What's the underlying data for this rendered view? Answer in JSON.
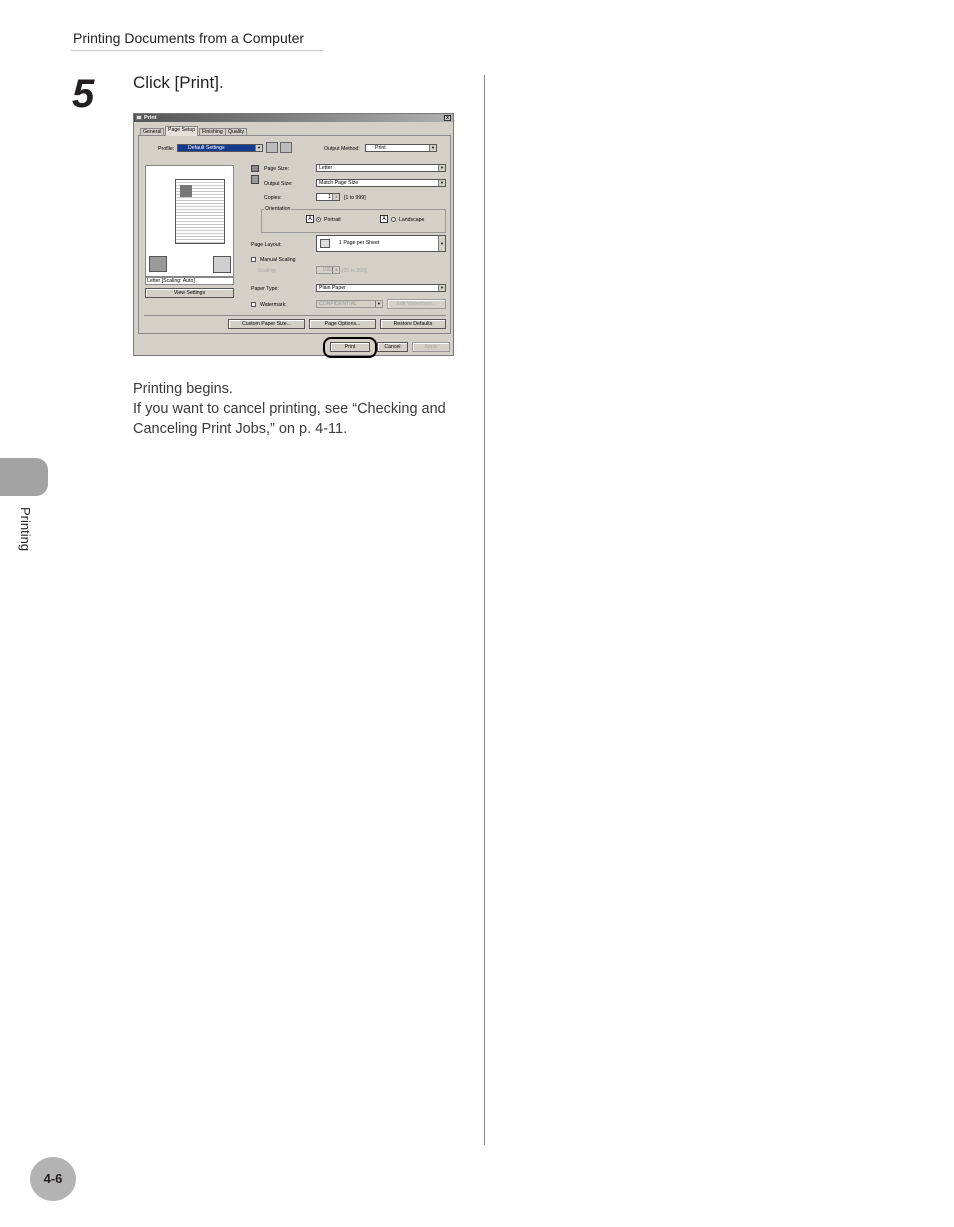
{
  "header": {
    "title": "Printing Documents from a Computer"
  },
  "step": {
    "number": "5",
    "instruction": "Click [Print]."
  },
  "body": {
    "line1": "Printing begins.",
    "line2": "If you want to cancel printing, see “Checking and Canceling Print Jobs,” on p. 4-11."
  },
  "side_tab": {
    "label": "Printing"
  },
  "page_number": "4-6",
  "dialog": {
    "title": "Print",
    "close": "x",
    "tabs": [
      "General",
      "Page Setup",
      "Finishing",
      "Quality"
    ],
    "profile_label": "Profile:",
    "profile_value": "Default Settings",
    "output_method_label": "Output Method:",
    "output_method_value": "Print",
    "preview_caption": "Letter [Scaling: Auto]",
    "view_settings": "View Settings",
    "page_size_label": "Page Size:",
    "page_size_value": "Letter",
    "output_size_label": "Output Size:",
    "output_size_value": "Match Page Size",
    "copies_label": "Copies:",
    "copies_value": "1",
    "copies_range": "[1 to 999]",
    "orientation_label": "Orientation",
    "portrait": "Portrait",
    "landscape": "Landscape",
    "page_layout_label": "Page Layout:",
    "page_layout_value": "1 Page per Sheet",
    "manual_scaling": "Manual Scaling",
    "scaling_label": "Scaling:",
    "scaling_value": "100",
    "scaling_range": "[25 to 200]",
    "paper_type_label": "Paper Type:",
    "paper_type_value": "Plain Paper",
    "watermark_label": "Watermark:",
    "watermark_value": "CONFIDENTIAL",
    "edit_watermark": "Edit Watermark...",
    "custom_paper": "Custom Paper Size...",
    "page_options": "Page Options...",
    "restore_defaults": "Restore Defaults",
    "print": "Print",
    "cancel": "Cancel",
    "apply": "Apply"
  }
}
